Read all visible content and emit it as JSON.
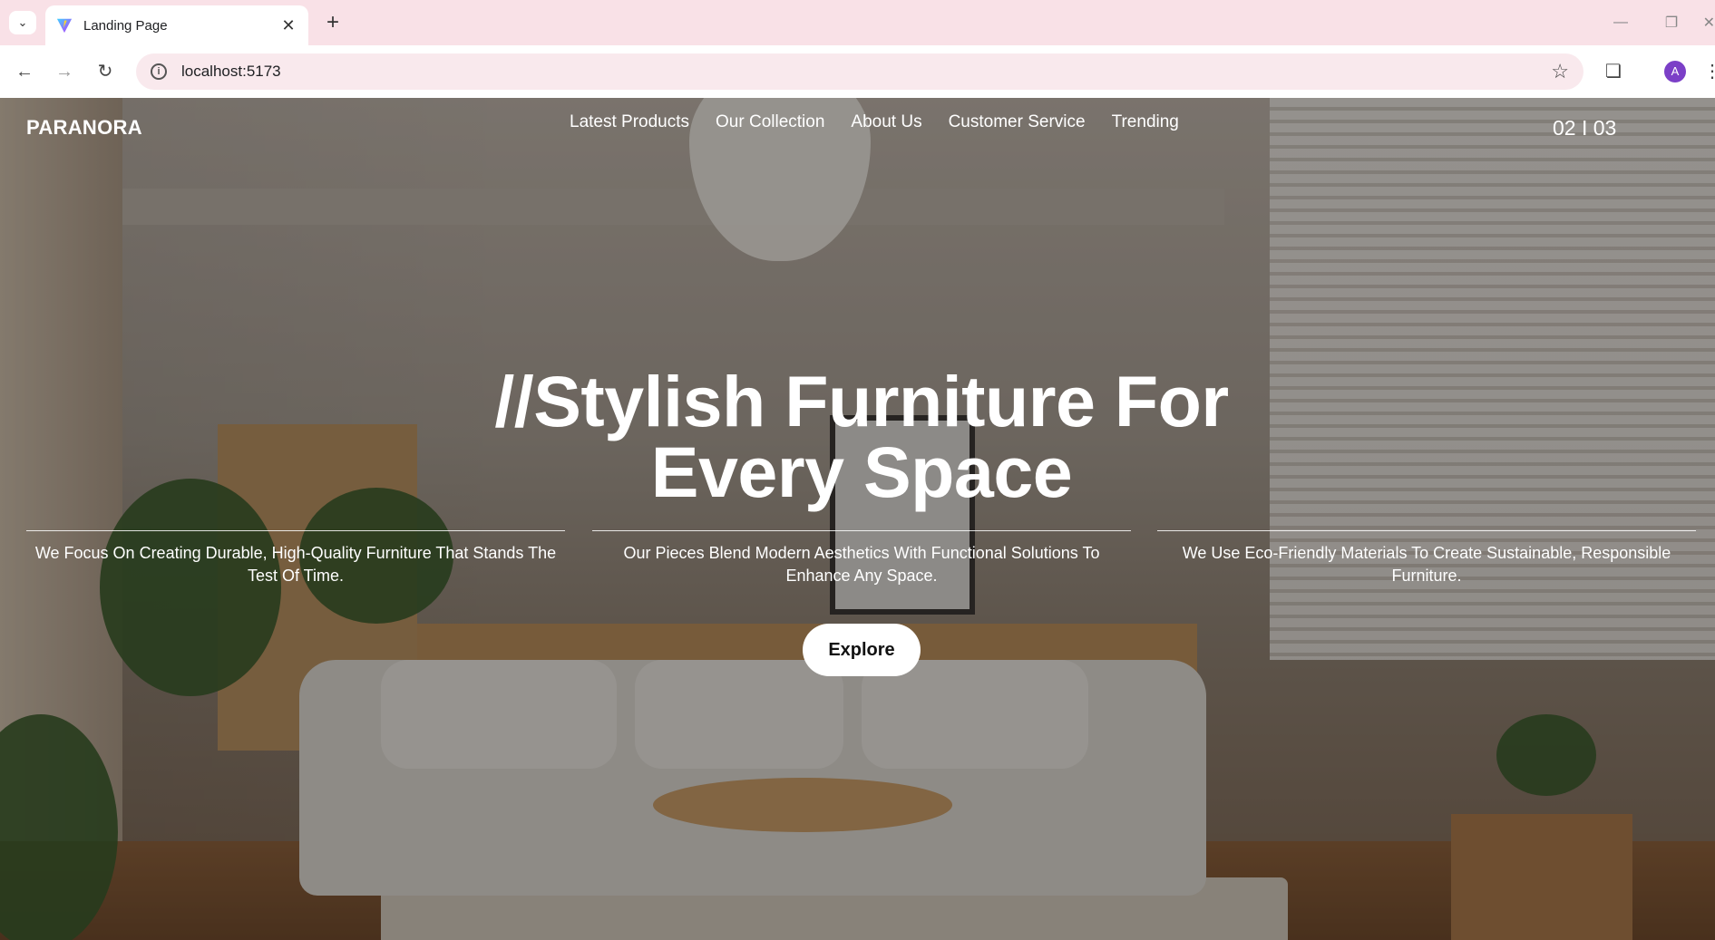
{
  "browser": {
    "tab_title": "Landing Page",
    "url": "localhost:5173",
    "profile_initial": "A"
  },
  "page": {
    "brand": "PARANORA",
    "nav": [
      "Latest Products",
      "Our Collection",
      "About Us",
      "Customer Service",
      "Trending"
    ],
    "slide_counter": "02 I 03",
    "headline_line1": "//Stylish Furniture For",
    "headline_line2": "Every Space",
    "features": [
      "We Focus On Creating Durable, High-Quality Furniture That Stands The Test Of Time.",
      "Our Pieces Blend Modern Aesthetics With Functional Solutions To Enhance Any Space.",
      "We Use Eco-Friendly Materials To Create Sustainable, Responsible Furniture."
    ],
    "cta_label": "Explore"
  },
  "colors": {
    "tabbar_bg": "#f9e1e7",
    "omnibox_bg": "#f9e9ed",
    "profile": "#7b3fc7",
    "hero_text": "#ffffff"
  }
}
